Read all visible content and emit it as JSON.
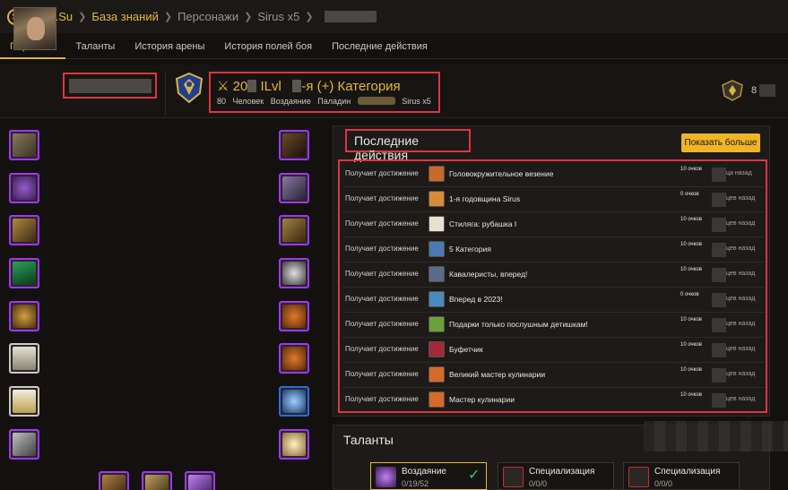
{
  "breadcrumb": {
    "site": "Sirus.Su",
    "items": [
      "База знаний",
      "Персонажи",
      "Sirus x5"
    ]
  },
  "tabs": [
    "Персонаж",
    "Таланты",
    "История арены",
    "История полей боя",
    "Последние действия"
  ],
  "character": {
    "level_ilvl_prefix": "20",
    "ilvl_label": "ILvl",
    "category": "-я (+) Категория",
    "level": "80",
    "race": "Человек",
    "spec": "Воздаяние",
    "class": "Паладин",
    "realm": "Sirus x5",
    "rating_prefix": "8"
  },
  "gear_left": [
    {
      "icon": "helmet-icon",
      "quality": "epic"
    },
    {
      "icon": "necklace-icon",
      "quality": "epic"
    },
    {
      "icon": "shoulder-icon",
      "quality": "epic"
    },
    {
      "icon": "cloak-icon",
      "quality": "epic"
    },
    {
      "icon": "chest-armor-icon",
      "quality": "epic"
    },
    {
      "icon": "shirt-icon",
      "quality": "common"
    },
    {
      "icon": "tabard-icon",
      "quality": "common"
    },
    {
      "icon": "bracers-icon",
      "quality": "epic"
    }
  ],
  "gear_right": [
    {
      "icon": "gloves-icon",
      "quality": "epic"
    },
    {
      "icon": "belt-icon",
      "quality": "epic"
    },
    {
      "icon": "legs-icon",
      "quality": "epic"
    },
    {
      "icon": "boots-icon",
      "quality": "epic"
    },
    {
      "icon": "pumpkin-ring-icon",
      "quality": "epic"
    },
    {
      "icon": "pumpkin-ring-icon",
      "quality": "epic"
    },
    {
      "icon": "trinket-icon",
      "quality": "blue"
    },
    {
      "icon": "trinket-star-icon",
      "quality": "epic"
    }
  ],
  "recent": {
    "title": "Последние действия",
    "more_button": "Показать больше",
    "rows": [
      {
        "action": "Получает достижение",
        "title": "Головокружительное везение",
        "points": "10 очков",
        "ago": "месяца назад",
        "icon_color": "#c46a2a"
      },
      {
        "action": "Получает достижение",
        "title": "1-я годовщина Sirus",
        "points": "0 очков",
        "ago": "месяцев назад",
        "icon_color": "#d68a3a"
      },
      {
        "action": "Получает достижение",
        "title": "Стиляга: рубашка I",
        "points": "10 очков",
        "ago": "месяцев назад",
        "icon_color": "#e6e0d0"
      },
      {
        "action": "Получает достижение",
        "title": "5 Категория",
        "points": "10 очков",
        "ago": "месяцев назад",
        "icon_color": "#4a7ab0"
      },
      {
        "action": "Получает достижение",
        "title": "Кавалеристы, вперед!",
        "points": "10 очков",
        "ago": "месяцев назад",
        "icon_color": "#5a6a8a"
      },
      {
        "action": "Получает достижение",
        "title": "Вперед в 2023!",
        "points": "0 очков",
        "ago": "месяцев назад",
        "icon_color": "#4a8ac0"
      },
      {
        "action": "Получает достижение",
        "title": "Подарки только послушным детишкам!",
        "points": "10 очков",
        "ago": "месяцев назад",
        "icon_color": "#6aa03a"
      },
      {
        "action": "Получает достижение",
        "title": "Буфетчик",
        "points": "10 очков",
        "ago": "месяцев назад",
        "icon_color": "#a02a3a"
      },
      {
        "action": "Получает достижение",
        "title": "Великий мастер кулинарии",
        "points": "10 очков",
        "ago": "месяцев назад",
        "icon_color": "#d66a2a"
      },
      {
        "action": "Получает достижение",
        "title": "Мастер кулинарии",
        "points": "10 очков",
        "ago": "месяцев назад",
        "icon_color": "#d66a2a"
      }
    ]
  },
  "talents": {
    "title": "Таланты",
    "cards": [
      {
        "name": "Воздаяние",
        "value": "0/19/52"
      },
      {
        "name": "Специализация",
        "value": "0/0/0"
      },
      {
        "name": "Специализация",
        "value": "0/0/0"
      }
    ]
  },
  "colors": {
    "accent": "#e4b53a",
    "highlight": "#e1343e",
    "epic": "#a335ee",
    "rare": "#2a6bdc"
  }
}
